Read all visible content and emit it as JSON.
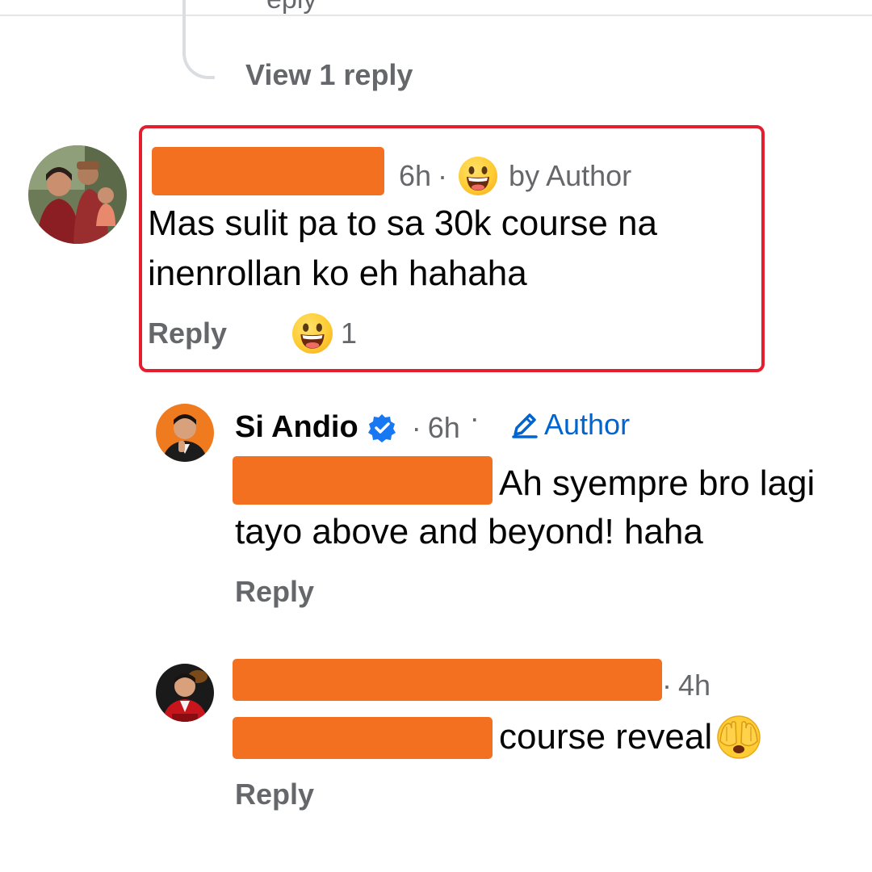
{
  "thread": {
    "view_replies_label": "View 1 reply"
  },
  "comments": [
    {
      "time": "6h",
      "separator": "·",
      "author_reaction_label": "by Author",
      "text_line1": "Mas sulit pa to sa 30k course na",
      "text_line2": "inenrollan ko eh hahaha",
      "reply_label": "Reply",
      "reaction_count": "1",
      "reaction_icon": "grinning-face-emoji"
    },
    {
      "name": "Si Andio",
      "verified_icon": "verified-badge-icon",
      "time": "6h",
      "separator": "·",
      "author_badge": "Author",
      "author_badge_icon": "pencil-icon",
      "text_line1": "Ah syempre bro lagi",
      "text_line2": "tayo above and beyond! haha",
      "reply_label": "Reply"
    },
    {
      "time": "4h",
      "separator": "·",
      "text": "course reveal",
      "text_emoji": "face-with-hands-over-eyes-emoji",
      "reply_label": "Reply"
    }
  ],
  "colors": {
    "redaction": "#f37021",
    "highlight_border": "#e41e2e",
    "link_blue": "#0064d1",
    "meta_gray": "#65676b"
  }
}
